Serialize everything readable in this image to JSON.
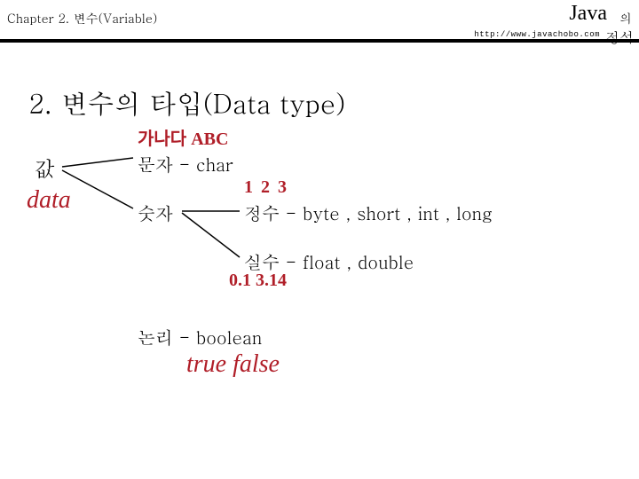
{
  "header": {
    "chapter": "Chapter 2. 변수(Variable)",
    "java": "Java",
    "eui": "의",
    "jeongseok": "정석",
    "url": "http://www.javachobo.com"
  },
  "title": "2. 변수의 타입(Data type)",
  "value_label": "값",
  "handwriting": {
    "data": "data",
    "abc": "가나다 ABC",
    "num123": "1 2 3",
    "decimals": "0.1  3.14",
    "truefalse": "true false"
  },
  "lines": {
    "char": "문자 - char",
    "number": "숫자",
    "integer": "정수  - byte , short , int , long",
    "real": "실수  - float , double",
    "boolean": "논리 - boolean"
  }
}
